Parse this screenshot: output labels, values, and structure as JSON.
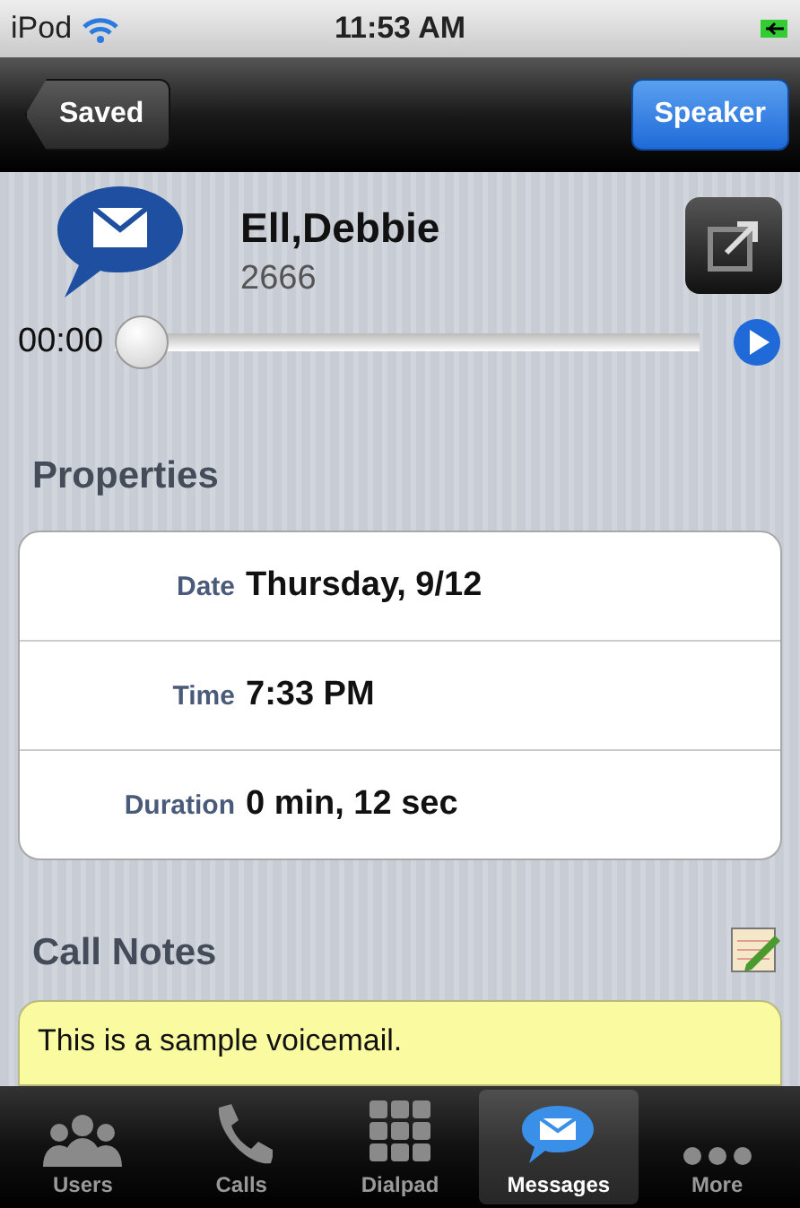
{
  "status_bar": {
    "carrier": "iPod",
    "time": "11:53 AM"
  },
  "nav_bar": {
    "back": "Saved",
    "action": "Speaker"
  },
  "contact": {
    "name": "Ell,Debbie",
    "extension": "2666"
  },
  "player": {
    "elapsed": "00:00",
    "level": 0
  },
  "properties": {
    "title": "Properties",
    "rows": [
      {
        "label": "Date",
        "value": "Thursday, 9/12"
      },
      {
        "label": "Time",
        "value": "7:33 PM"
      },
      {
        "label": "Duration",
        "value": "0 min, 12 sec"
      }
    ]
  },
  "call_notes": {
    "title": "Call Notes",
    "text": "This is a sample voicemail."
  },
  "tab_bar": [
    {
      "kind": "users",
      "label": "Users",
      "selected": false
    },
    {
      "kind": "calls",
      "label": "Calls",
      "selected": false
    },
    {
      "kind": "dialpad",
      "label": "Dialpad",
      "selected": false
    },
    {
      "kind": "messages",
      "label": "Messages",
      "selected": true
    },
    {
      "kind": "more",
      "label": "More",
      "selected": false
    }
  ]
}
